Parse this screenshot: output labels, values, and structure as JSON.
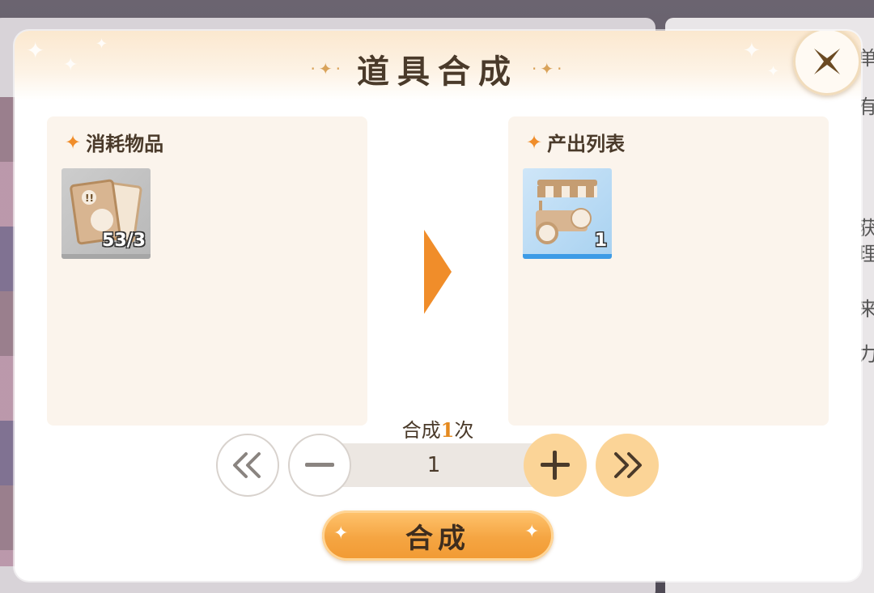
{
  "dialog": {
    "title": "道具合成",
    "title_deco_left": "·✦·",
    "title_deco_right": "·✦·"
  },
  "consume_panel": {
    "title": "消耗物品",
    "item": {
      "icon": "card-pack-icon",
      "count": "53/3"
    }
  },
  "output_panel": {
    "title": "产出列表",
    "item": {
      "icon": "food-cart-icon",
      "count": "1"
    }
  },
  "craft": {
    "label_prefix": "合成",
    "times": "1",
    "label_suffix": "次",
    "quantity_value": "1",
    "button_label": "合成"
  },
  "background": {
    "right_chars": [
      "单",
      "有",
      "获",
      "理",
      "来",
      "力"
    ]
  },
  "colors": {
    "accent_orange": "#f08d2a",
    "title_text": "#4a3a2a",
    "panel_bg": "#fbf4ec",
    "button_gold": "#fbd497"
  }
}
